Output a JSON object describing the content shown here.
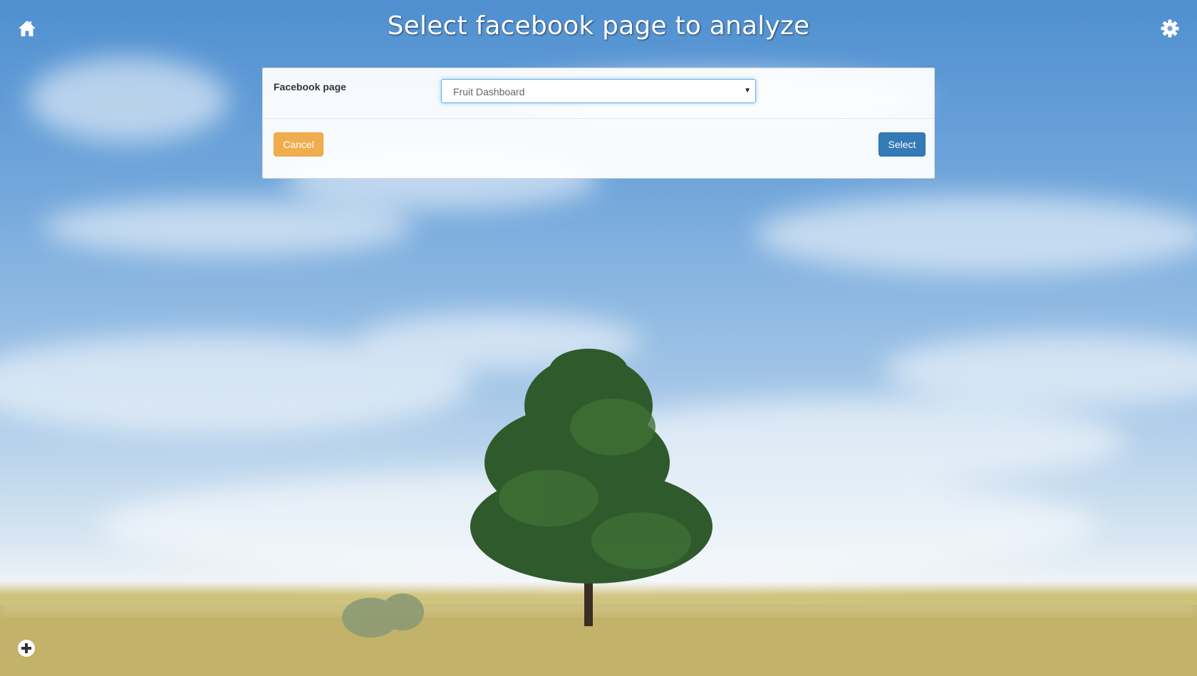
{
  "header": {
    "title": "Select facebook page to analyze",
    "home_icon": "home-icon",
    "settings_icon": "gear-icon"
  },
  "form": {
    "field_label": "Facebook page",
    "select": {
      "selected_value": "Fruit Dashboard"
    },
    "cancel_label": "Cancel",
    "select_label": "Select"
  },
  "footer": {
    "add_icon": "plus-circle-icon"
  },
  "colors": {
    "cancel_button": "#f0ad4e",
    "select_button": "#337ab7",
    "focus_border": "#66afe9"
  }
}
